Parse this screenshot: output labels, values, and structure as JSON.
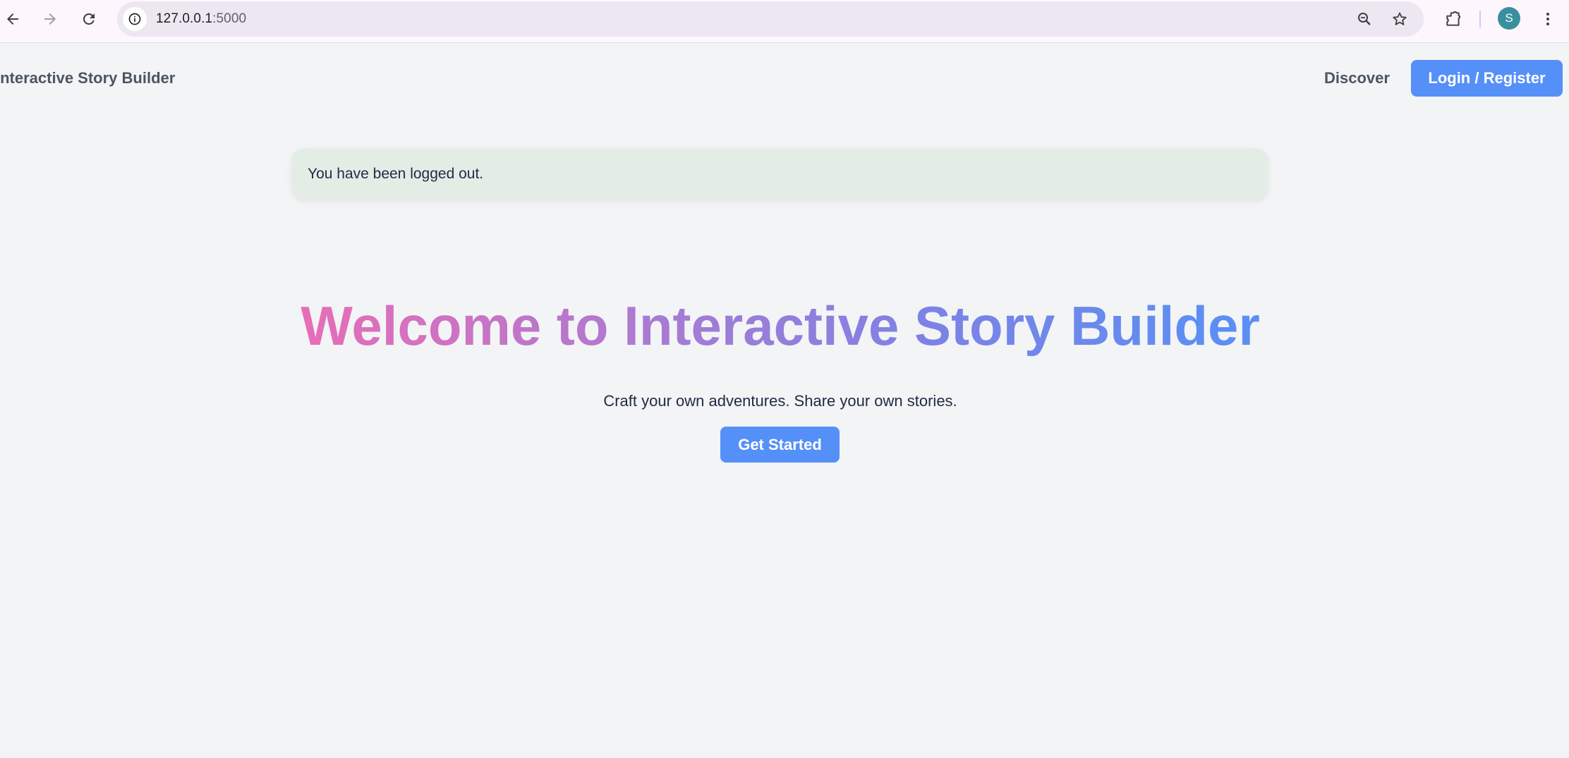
{
  "browser": {
    "url_host": "127.0.0.1",
    "url_port": ":5000",
    "profile_initial": "S",
    "icons": [
      "back-arrow-icon",
      "forward-arrow-icon",
      "reload-icon",
      "site-info-icon",
      "zoom-icon",
      "bookmark-star-icon",
      "extensions-icon",
      "kebab-menu-icon"
    ]
  },
  "header": {
    "brand": "Interactive Story Builder",
    "discover_label": "Discover",
    "login_label": "Login / Register"
  },
  "flash": {
    "message": "You have been logged out."
  },
  "hero": {
    "title": "Welcome to Interactive Story Builder",
    "subtitle": "Craft your own adventures. Share your own stories.",
    "cta_label": "Get Started"
  },
  "colors": {
    "primary": "#5590f8",
    "flash_bg": "#e3ede6",
    "page_bg": "#f3f4f6",
    "gradient_start": "#e86db7",
    "gradient_end": "#5890f5"
  }
}
